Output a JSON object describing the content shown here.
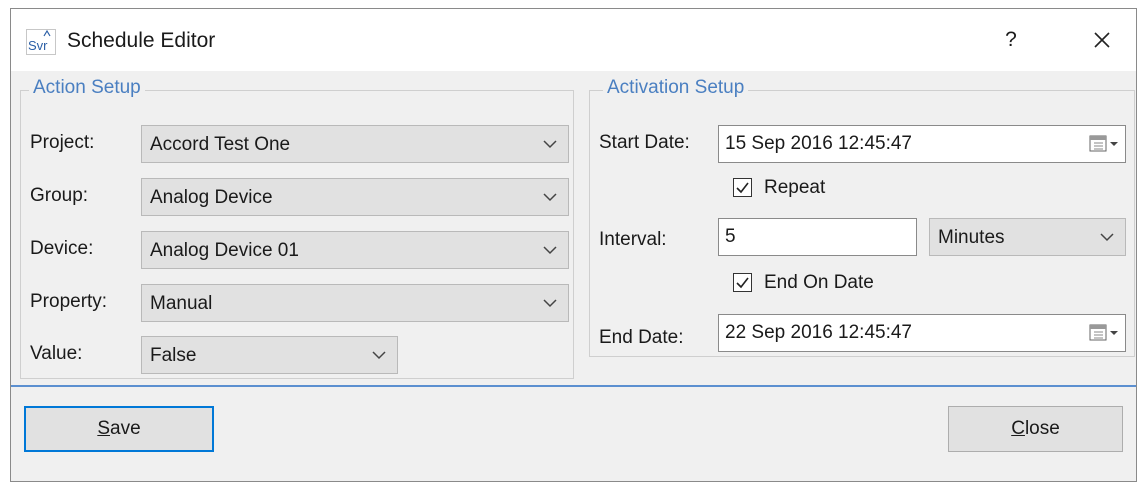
{
  "window": {
    "app_icon_text": "Svr",
    "title": "Schedule Editor",
    "help_label": "?"
  },
  "action_setup": {
    "legend": "Action Setup",
    "project": {
      "label": "Project:",
      "value": "Accord Test One"
    },
    "group": {
      "label": "Group:",
      "value": "Analog Device"
    },
    "device": {
      "label": "Device:",
      "value": "Analog Device 01"
    },
    "property": {
      "label": "Property:",
      "value": "Manual"
    },
    "value": {
      "label": "Value:",
      "value": "False"
    }
  },
  "activation_setup": {
    "legend": "Activation Setup",
    "start_date": {
      "label": "Start Date:",
      "value": "15 Sep 2016 12:45:47"
    },
    "repeat": {
      "label": "Repeat",
      "checked": true
    },
    "interval": {
      "label": "Interval:",
      "value": "5",
      "unit": "Minutes"
    },
    "end_on_date": {
      "label": "End On Date",
      "checked": true
    },
    "end_date": {
      "label": "End Date:",
      "value": "22 Sep 2016 12:45:47"
    }
  },
  "buttons": {
    "save_first": "S",
    "save_rest": "ave",
    "close_first": "C",
    "close_rest": "lose"
  },
  "colors": {
    "accent": "#0078d7",
    "legend_text": "#4a7fc1",
    "dialog_bg": "#f0f0f0",
    "control_bg": "#e1e1e1"
  },
  "icons": [
    "app-icon",
    "help-icon",
    "close-icon",
    "chevron-down-icon",
    "calendar-icon",
    "checkmark-icon"
  ]
}
